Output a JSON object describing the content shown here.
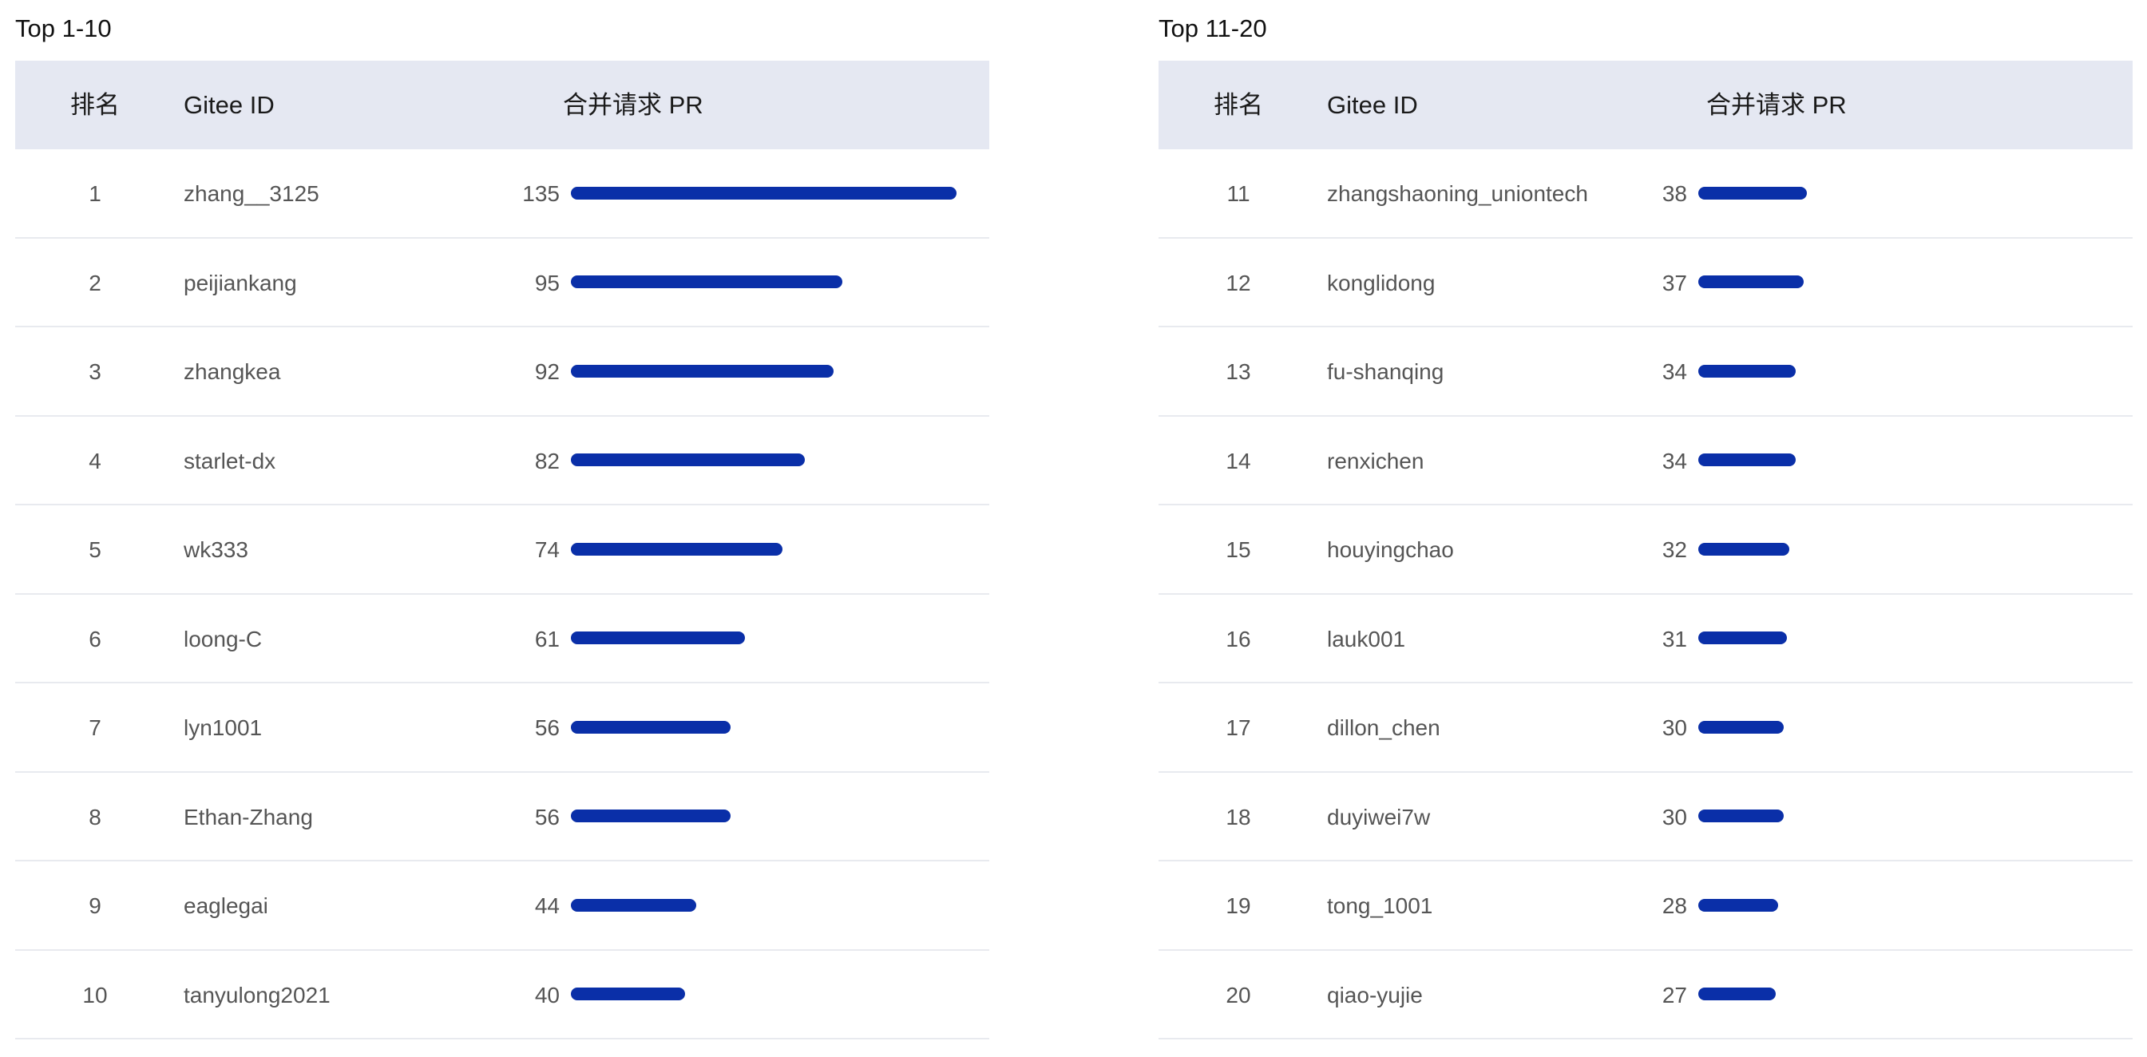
{
  "colors": {
    "bar": "#0a2fa8",
    "header_bg": "#e5e8f2"
  },
  "chart_data": [
    {
      "type": "table",
      "title": "Top 1-10",
      "columns": [
        "排名",
        "Gitee ID",
        "合并请求 PR"
      ],
      "max_value": 135,
      "rows": [
        {
          "rank": "1",
          "id": "zhang__3125",
          "value": 135
        },
        {
          "rank": "2",
          "id": "peijiankang",
          "value": 95
        },
        {
          "rank": "3",
          "id": "zhangkea",
          "value": 92
        },
        {
          "rank": "4",
          "id": "starlet-dx",
          "value": 82
        },
        {
          "rank": "5",
          "id": "wk333",
          "value": 74
        },
        {
          "rank": "6",
          "id": "loong-C",
          "value": 61
        },
        {
          "rank": "7",
          "id": "lyn1001",
          "value": 56
        },
        {
          "rank": "8",
          "id": "Ethan-Zhang",
          "value": 56
        },
        {
          "rank": "9",
          "id": "eaglegai",
          "value": 44
        },
        {
          "rank": "10",
          "id": "tanyulong2021",
          "value": 40
        }
      ]
    },
    {
      "type": "table",
      "title": "Top 11-20",
      "columns": [
        "排名",
        "Gitee ID",
        "合并请求 PR"
      ],
      "max_value": 135,
      "rows": [
        {
          "rank": "11",
          "id": "zhangshaoning_uniontech",
          "value": 38
        },
        {
          "rank": "12",
          "id": "konglidong",
          "value": 37
        },
        {
          "rank": "13",
          "id": "fu-shanqing",
          "value": 34
        },
        {
          "rank": "14",
          "id": "renxichen",
          "value": 34
        },
        {
          "rank": "15",
          "id": "houyingchao",
          "value": 32
        },
        {
          "rank": "16",
          "id": "lauk001",
          "value": 31
        },
        {
          "rank": "17",
          "id": "dillon_chen",
          "value": 30
        },
        {
          "rank": "18",
          "id": "duyiwei7w",
          "value": 30
        },
        {
          "rank": "19",
          "id": "tong_1001",
          "value": 28
        },
        {
          "rank": "20",
          "id": "qiao-yujie",
          "value": 27
        }
      ]
    }
  ]
}
